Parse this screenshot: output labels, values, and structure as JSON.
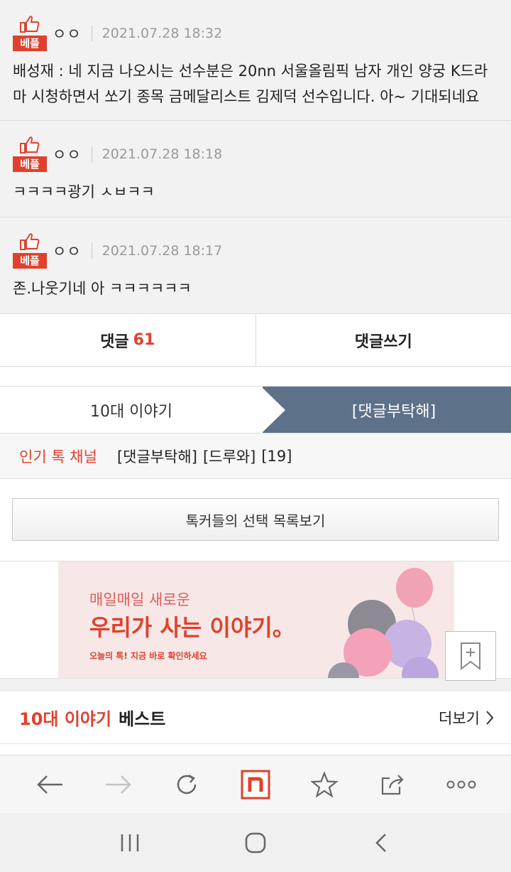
{
  "comments": [
    {
      "badge": "베플",
      "nick": "ㅇㅇ",
      "date": "2021.07.28 18:32",
      "text": "배성재 : 네 지금 나오시는 선수분은 20nn 서울올림픽 남자 개인 양궁 K드라마 시청하면서 쏘기 종목 금메달리스트 김제덕 선수입니다. 아~ 기대되네요"
    },
    {
      "badge": "베플",
      "nick": "ㅇㅇ",
      "date": "2021.07.28 18:18",
      "text": "ㅋㅋㅋㅋ광기 ㅅㅂㅋㅋ"
    },
    {
      "badge": "베플",
      "nick": "ㅇㅇ",
      "date": "2021.07.28 18:17",
      "text": "존.나웃기네 아 ㅋㅋㅋㅋㅋㅋ"
    }
  ],
  "reply_bar": {
    "label": "댓글",
    "count": "61",
    "write": "댓글쓰기"
  },
  "channel_tabs": {
    "left": "10대 이야기",
    "right": "[댓글부탁해]"
  },
  "popular": {
    "title": "인기 톡 채널",
    "tags": [
      "[댓글부탁해]",
      "[드루와]",
      "[19]"
    ]
  },
  "list_button": "톡커들의 선택 목록보기",
  "ad": {
    "line1": "매일매일 새로운",
    "line2": "우리가 사는 이야기。",
    "line3": "오늘의 톡! 지금 바로 확인하세요"
  },
  "best": {
    "highlight": "10대 이야기",
    "label": "베스트",
    "more": "더보기"
  },
  "colors": {
    "accent": "#e0412d",
    "tab_active": "#5d7189",
    "comment_bg": "#f2f2f2"
  },
  "icons": {
    "browser": [
      "back-arrow-icon",
      "forward-arrow-icon",
      "refresh-icon",
      "naver-n-icon",
      "star-icon",
      "share-icon",
      "more-dots-icon"
    ],
    "system": [
      "recent-apps-icon",
      "home-icon",
      "back-icon"
    ]
  }
}
